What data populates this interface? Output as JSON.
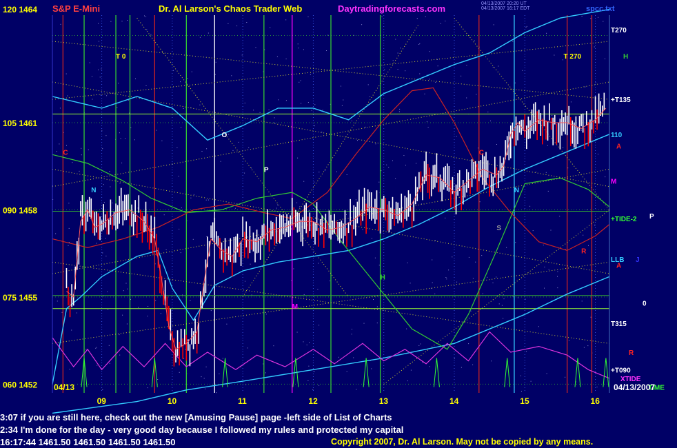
{
  "header": {
    "instrument": "S&P E-Mini",
    "title": "Dr. Al Larson's Chaos Trader Web",
    "website": "Daytradingforecasts.com",
    "file": "spcc.txt",
    "stamp_line1": "04/13/2007 20:20 UT",
    "stamp_line2": "04/13/2007 16:17 EDT"
  },
  "notes": [
    "3:07 if you are still here, check out the new [Amusing Pause] page -left side of List of Charts",
    "2:34 I'm done for the day - very good day because I followed my rules and protected my capital"
  ],
  "quote_line": "16:17:44  1461.50  1461.50  1461.50  1461.50",
  "copyright": "Copyright 2007, Dr. Al Larson. May not be copied by any means.",
  "colors": {
    "background": "#000066",
    "price_bars": "#ffffff",
    "down_bars": "#ff0000",
    "title": "#ffff00",
    "instrument": "#ff4040",
    "website": "#ff00ff",
    "cyan_bands": "#33ccff",
    "green_field": "#33cc33",
    "red_field": "#cc2222",
    "magenta_osc": "#dd33dd",
    "hour_grid": "#4466ff",
    "price_grid": "#33aa33"
  },
  "chart_data": {
    "type": "bar",
    "title": "S&P E-Mini",
    "date_left": "04/13",
    "date_right": "04/13/2007",
    "x_hours": [
      "09",
      "10",
      "11",
      "12",
      "13",
      "14",
      "15",
      "16"
    ],
    "xlim_hours": [
      8.3,
      16.2
    ],
    "ylim_price": [
      1451.7,
      1464.7
    ],
    "y_ticks": [
      {
        "index": "120",
        "price": "1464",
        "value": 1464
      },
      {
        "index": "105",
        "price": "1461",
        "value": 1461
      },
      {
        "index": "090",
        "price": "1458",
        "value": 1458
      },
      {
        "index": "075",
        "price": "1455",
        "value": 1455
      },
      {
        "index": "060",
        "price": "1452",
        "value": 1452
      }
    ],
    "last_price": 1461.5,
    "price_series": [
      {
        "t": 8.5,
        "p": 1455.2
      },
      {
        "t": 8.6,
        "p": 1455.0
      },
      {
        "t": 8.7,
        "p": 1457.6
      },
      {
        "t": 8.8,
        "p": 1458.0
      },
      {
        "t": 8.9,
        "p": 1457.4
      },
      {
        "t": 9.0,
        "p": 1457.5
      },
      {
        "t": 9.2,
        "p": 1457.9
      },
      {
        "t": 9.4,
        "p": 1458.0
      },
      {
        "t": 9.6,
        "p": 1457.6
      },
      {
        "t": 9.75,
        "p": 1457.0
      },
      {
        "t": 9.85,
        "p": 1455.6
      },
      {
        "t": 9.95,
        "p": 1454.0
      },
      {
        "t": 10.05,
        "p": 1453.2
      },
      {
        "t": 10.2,
        "p": 1453.4
      },
      {
        "t": 10.35,
        "p": 1453.8
      },
      {
        "t": 10.45,
        "p": 1455.5
      },
      {
        "t": 10.55,
        "p": 1457.0
      },
      {
        "t": 10.7,
        "p": 1456.6
      },
      {
        "t": 10.85,
        "p": 1456.4
      },
      {
        "t": 11.0,
        "p": 1457.0
      },
      {
        "t": 11.2,
        "p": 1456.9
      },
      {
        "t": 11.4,
        "p": 1457.3
      },
      {
        "t": 11.6,
        "p": 1457.4
      },
      {
        "t": 11.8,
        "p": 1457.6
      },
      {
        "t": 12.0,
        "p": 1457.6
      },
      {
        "t": 12.2,
        "p": 1457.3
      },
      {
        "t": 12.4,
        "p": 1457.4
      },
      {
        "t": 12.6,
        "p": 1457.7
      },
      {
        "t": 12.8,
        "p": 1458.1
      },
      {
        "t": 13.0,
        "p": 1458.0
      },
      {
        "t": 13.2,
        "p": 1457.8
      },
      {
        "t": 13.4,
        "p": 1458.2
      },
      {
        "t": 13.6,
        "p": 1459.2
      },
      {
        "t": 13.8,
        "p": 1459.1
      },
      {
        "t": 14.0,
        "p": 1458.6
      },
      {
        "t": 14.2,
        "p": 1459.0
      },
      {
        "t": 14.4,
        "p": 1459.4
      },
      {
        "t": 14.6,
        "p": 1459.2
      },
      {
        "t": 14.7,
        "p": 1459.5
      },
      {
        "t": 14.8,
        "p": 1460.6
      },
      {
        "t": 14.9,
        "p": 1461.0
      },
      {
        "t": 15.0,
        "p": 1460.7
      },
      {
        "t": 15.2,
        "p": 1461.1
      },
      {
        "t": 15.4,
        "p": 1461.0
      },
      {
        "t": 15.6,
        "p": 1461.0
      },
      {
        "t": 15.8,
        "p": 1460.8
      },
      {
        "t": 16.0,
        "p": 1461.1
      },
      {
        "t": 16.15,
        "p": 1461.5
      }
    ],
    "cyan_upper": [
      {
        "t": 8.3,
        "p": 1461.9
      },
      {
        "t": 9.0,
        "p": 1461.5
      },
      {
        "t": 9.5,
        "p": 1461.9
      },
      {
        "t": 10.0,
        "p": 1461.5
      },
      {
        "t": 10.5,
        "p": 1460.4
      },
      {
        "t": 11.0,
        "p": 1460.9
      },
      {
        "t": 11.5,
        "p": 1461.5
      },
      {
        "t": 12.0,
        "p": 1461.5
      },
      {
        "t": 12.5,
        "p": 1461.1
      },
      {
        "t": 13.0,
        "p": 1462.0
      },
      {
        "t": 13.5,
        "p": 1462.5
      },
      {
        "t": 14.0,
        "p": 1463.0
      },
      {
        "t": 14.5,
        "p": 1463.4
      },
      {
        "t": 15.0,
        "p": 1464.1
      },
      {
        "t": 15.5,
        "p": 1464.6
      },
      {
        "t": 16.2,
        "p": 1464.9
      }
    ],
    "cyan_lower": [
      {
        "t": 8.3,
        "p": 1452.0
      },
      {
        "t": 8.5,
        "p": 1454.6
      },
      {
        "t": 8.7,
        "p": 1455.0
      },
      {
        "t": 9.0,
        "p": 1455.7
      },
      {
        "t": 9.5,
        "p": 1456.4
      },
      {
        "t": 9.8,
        "p": 1456.6
      },
      {
        "t": 10.0,
        "p": 1455.3
      },
      {
        "t": 10.3,
        "p": 1454.2
      },
      {
        "t": 10.6,
        "p": 1455.4
      },
      {
        "t": 11.0,
        "p": 1455.9
      },
      {
        "t": 11.5,
        "p": 1456.2
      },
      {
        "t": 12.0,
        "p": 1456.4
      },
      {
        "t": 12.5,
        "p": 1456.6
      },
      {
        "t": 13.0,
        "p": 1457.0
      },
      {
        "t": 13.5,
        "p": 1457.5
      },
      {
        "t": 14.0,
        "p": 1458.1
      },
      {
        "t": 14.5,
        "p": 1458.8
      },
      {
        "t": 15.0,
        "p": 1459.4
      },
      {
        "t": 15.5,
        "p": 1459.9
      },
      {
        "t": 16.2,
        "p": 1460.6
      }
    ],
    "cyan_bottom": [
      {
        "t": 8.3,
        "p": 1451.0
      },
      {
        "t": 9.5,
        "p": 1451.4
      },
      {
        "t": 10.2,
        "p": 1451.8
      },
      {
        "t": 11.0,
        "p": 1452.1
      },
      {
        "t": 12.0,
        "p": 1452.5
      },
      {
        "t": 13.0,
        "p": 1452.9
      },
      {
        "t": 14.0,
        "p": 1453.4
      },
      {
        "t": 15.0,
        "p": 1454.4
      },
      {
        "t": 15.6,
        "p": 1455.1
      },
      {
        "t": 16.2,
        "p": 1455.7
      }
    ],
    "green_field": [
      {
        "t": 8.3,
        "p": 1459.9
      },
      {
        "t": 8.8,
        "p": 1459.6
      },
      {
        "t": 9.3,
        "p": 1459.0
      },
      {
        "t": 9.7,
        "p": 1458.4
      },
      {
        "t": 10.2,
        "p": 1457.9
      },
      {
        "t": 10.7,
        "p": 1458.0
      },
      {
        "t": 11.2,
        "p": 1458.4
      },
      {
        "t": 11.7,
        "p": 1458.6
      },
      {
        "t": 12.0,
        "p": 1458.2
      },
      {
        "t": 12.4,
        "p": 1456.9
      },
      {
        "t": 12.9,
        "p": 1455.4
      },
      {
        "t": 13.4,
        "p": 1453.9
      },
      {
        "t": 13.9,
        "p": 1453.2
      },
      {
        "t": 14.2,
        "p": 1454.4
      },
      {
        "t": 14.6,
        "p": 1456.6
      },
      {
        "t": 15.0,
        "p": 1458.9
      },
      {
        "t": 15.5,
        "p": 1459.1
      },
      {
        "t": 15.9,
        "p": 1458.7
      },
      {
        "t": 16.2,
        "p": 1458.1
      }
    ],
    "red_field": [
      {
        "t": 8.3,
        "p": 1457.0
      },
      {
        "t": 8.8,
        "p": 1456.7
      },
      {
        "t": 9.3,
        "p": 1457.0
      },
      {
        "t": 9.8,
        "p": 1457.4
      },
      {
        "t": 10.3,
        "p": 1458.0
      },
      {
        "t": 10.8,
        "p": 1458.2
      },
      {
        "t": 11.3,
        "p": 1457.9
      },
      {
        "t": 11.7,
        "p": 1457.7
      },
      {
        "t": 12.2,
        "p": 1458.6
      },
      {
        "t": 12.6,
        "p": 1459.9
      },
      {
        "t": 13.0,
        "p": 1461.1
      },
      {
        "t": 13.4,
        "p": 1462.1
      },
      {
        "t": 13.7,
        "p": 1462.2
      },
      {
        "t": 14.0,
        "p": 1461.0
      },
      {
        "t": 14.4,
        "p": 1459.1
      },
      {
        "t": 14.8,
        "p": 1457.9
      },
      {
        "t": 15.2,
        "p": 1456.9
      },
      {
        "t": 15.6,
        "p": 1456.6
      },
      {
        "t": 16.0,
        "p": 1457.1
      },
      {
        "t": 16.2,
        "p": 1457.5
      }
    ],
    "magenta_osc": [
      {
        "t": 8.3,
        "p": 1453.6
      },
      {
        "t": 8.6,
        "p": 1452.6
      },
      {
        "t": 8.8,
        "p": 1453.2
      },
      {
        "t": 9.0,
        "p": 1452.5
      },
      {
        "t": 9.3,
        "p": 1453.3
      },
      {
        "t": 9.6,
        "p": 1452.6
      },
      {
        "t": 9.9,
        "p": 1453.4
      },
      {
        "t": 10.2,
        "p": 1452.6
      },
      {
        "t": 10.5,
        "p": 1453.1
      },
      {
        "t": 10.9,
        "p": 1452.5
      },
      {
        "t": 11.2,
        "p": 1453.0
      },
      {
        "t": 11.6,
        "p": 1452.6
      },
      {
        "t": 12.0,
        "p": 1453.2
      },
      {
        "t": 12.3,
        "p": 1452.7
      },
      {
        "t": 12.7,
        "p": 1453.4
      },
      {
        "t": 13.0,
        "p": 1452.8
      },
      {
        "t": 13.3,
        "p": 1453.2
      },
      {
        "t": 13.6,
        "p": 1452.7
      },
      {
        "t": 13.9,
        "p": 1453.4
      },
      {
        "t": 14.2,
        "p": 1452.8
      },
      {
        "t": 14.5,
        "p": 1453.8
      },
      {
        "t": 14.8,
        "p": 1453.1
      },
      {
        "t": 15.2,
        "p": 1453.3
      },
      {
        "t": 15.6,
        "p": 1453.0
      },
      {
        "t": 15.9,
        "p": 1452.5
      },
      {
        "t": 16.2,
        "p": 1452.2
      }
    ],
    "vertical_markers": [
      {
        "t": 8.45,
        "color": "#cc2222"
      },
      {
        "t": 8.75,
        "color": "#33cc33"
      },
      {
        "t": 9.2,
        "color": "#33cc33"
      },
      {
        "t": 9.4,
        "color": "#33cc33"
      },
      {
        "t": 9.75,
        "color": "#cc2222"
      },
      {
        "t": 10.2,
        "color": "#33cc33"
      },
      {
        "t": 10.6,
        "color": "#ffffff"
      },
      {
        "t": 11.3,
        "color": "#33cc33"
      },
      {
        "t": 11.7,
        "color": "#ff00ff"
      },
      {
        "t": 12.25,
        "color": "#33cc33"
      },
      {
        "t": 12.95,
        "color": "#33cc33"
      },
      {
        "t": 14.35,
        "color": "#cc2222"
      },
      {
        "t": 14.85,
        "color": "#33ccff"
      },
      {
        "t": 15.6,
        "color": "#cc2222"
      },
      {
        "t": 15.95,
        "color": "#cc2222"
      },
      {
        "t": 16.2,
        "color": "#33cc33"
      }
    ],
    "horizontal_markers": [
      {
        "p": 1461.3,
        "color": "#99ff33"
      },
      {
        "p": 1457.95,
        "color": "#33aa33"
      },
      {
        "p": 1455.05,
        "color": "#33aa33"
      },
      {
        "p": 1454.6,
        "color": "#99ff33"
      }
    ],
    "right_labels": [
      {
        "text": "T270",
        "p": 1464.2,
        "color": "#ffffff"
      },
      {
        "text": "H",
        "p": 1463.3,
        "color": "#33cc33"
      },
      {
        "text": "+T135",
        "p": 1461.8,
        "color": "#ffffff"
      },
      {
        "text": "110",
        "p": 1460.6,
        "color": "#33ccff"
      },
      {
        "text": "A",
        "p": 1460.2,
        "color": "#ff2222"
      },
      {
        "text": "M",
        "p": 1459.0,
        "color": "#ff00ff"
      },
      {
        "text": "+TIDE-2",
        "p": 1457.7,
        "color": "#33ff33"
      },
      {
        "text": "P",
        "p": 1457.8,
        "color": "#ffffff"
      },
      {
        "text": "LLB",
        "p": 1456.3,
        "color": "#33ccff"
      },
      {
        "text": "J",
        "p": 1456.3,
        "color": "#3333ff"
      },
      {
        "text": "A",
        "p": 1456.1,
        "color": "#ff2222"
      },
      {
        "text": "0",
        "p": 1454.8,
        "color": "#ffffff"
      },
      {
        "text": "T315",
        "p": 1454.1,
        "color": "#ffffff"
      },
      {
        "text": "R",
        "p": 1453.1,
        "color": "#ff2222"
      },
      {
        "text": "+T090",
        "p": 1452.5,
        "color": "#ffffff"
      },
      {
        "text": "XTIDE",
        "p": 1452.2,
        "color": "#ff33ff"
      },
      {
        "text": "TIME",
        "p": 1451.9,
        "color": "#33ff33"
      }
    ],
    "chart_annotations": [
      {
        "text": "T 0",
        "t": 9.2,
        "p": 1463.2,
        "color": "#ffff00"
      },
      {
        "text": "T 270",
        "t": 15.55,
        "p": 1463.2,
        "color": "#ffff00"
      },
      {
        "text": "C",
        "t": 8.45,
        "p": 1459.9,
        "color": "#ff2222"
      },
      {
        "text": "N",
        "t": 8.85,
        "p": 1458.6,
        "color": "#33ccff"
      },
      {
        "text": "O",
        "t": 10.7,
        "p": 1460.5,
        "color": "#ffffff"
      },
      {
        "text": "P",
        "t": 11.3,
        "p": 1459.3,
        "color": "#ffffff"
      },
      {
        "text": "M",
        "t": 11.7,
        "p": 1454.6,
        "color": "#ff00ff"
      },
      {
        "text": "H",
        "t": 12.95,
        "p": 1455.6,
        "color": "#33cc33"
      },
      {
        "text": "C",
        "t": 14.35,
        "p": 1459.9,
        "color": "#ff2222"
      },
      {
        "text": "N",
        "t": 14.85,
        "p": 1458.6,
        "color": "#33ccff"
      },
      {
        "text": "S",
        "t": 14.6,
        "p": 1457.3,
        "color": "#999999"
      },
      {
        "text": "R",
        "t": 15.8,
        "p": 1456.5,
        "color": "#ff2222"
      }
    ]
  }
}
